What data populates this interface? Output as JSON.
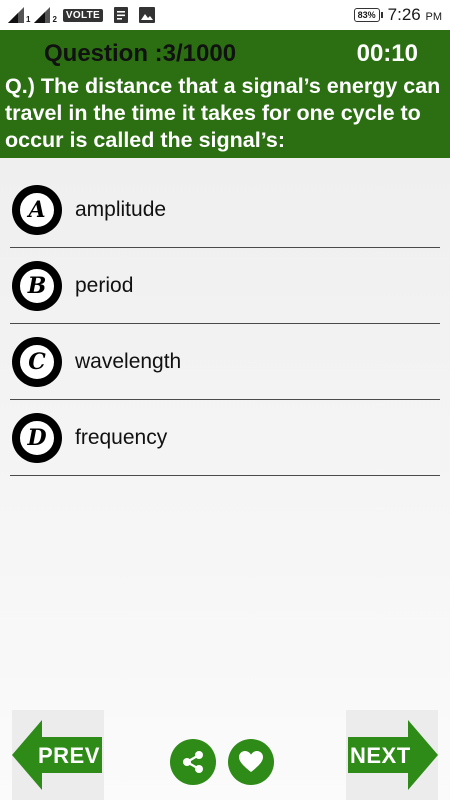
{
  "status_bar": {
    "sim1_label": "1",
    "sim2_label": "2",
    "volte_label": "VOLTE",
    "battery_label": "83%",
    "time": "7:26",
    "time_suffix": "PM"
  },
  "header": {
    "question_counter": "Question :3/1000",
    "timer": "00:10",
    "question_text": "Q.) The distance that a signal’s energy can travel in the time it takes for one cycle to occur is called the signal’s:"
  },
  "options": [
    {
      "letter": "A",
      "text": "amplitude"
    },
    {
      "letter": "B",
      "text": "period"
    },
    {
      "letter": "C",
      "text": "wavelength"
    },
    {
      "letter": "D",
      "text": "frequency"
    }
  ],
  "navigation": {
    "prev_label": "PREV",
    "next_label": "NEXT"
  },
  "icons": {
    "share": "share-icon",
    "favorite": "heart-icon"
  },
  "colors": {
    "header_bg": "#2c6f12",
    "accent_green": "#2e8b18",
    "option_badge": "#000000"
  }
}
